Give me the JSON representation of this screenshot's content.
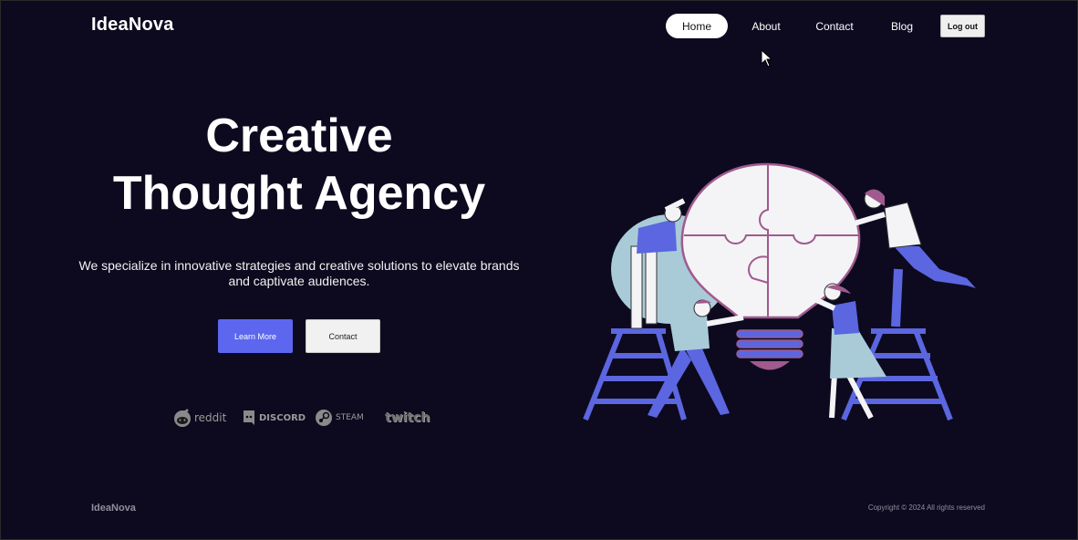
{
  "header": {
    "brand": "IdeaNova",
    "nav": [
      {
        "label": "Home",
        "active": true
      },
      {
        "label": "About",
        "active": false
      },
      {
        "label": "Contact",
        "active": false
      },
      {
        "label": "Blog",
        "active": false
      }
    ],
    "logout_label": "Log out"
  },
  "hero": {
    "title_line1": "Creative",
    "title_line2": "Thought Agency",
    "subtitle": "We specialize in innovative strategies and creative solutions to elevate brands and captivate audiences.",
    "primary_button": "Learn More",
    "secondary_button": "Contact"
  },
  "partners": [
    {
      "name": "reddit",
      "icon": "reddit-icon"
    },
    {
      "name": "DISCORD",
      "icon": "discord-icon"
    },
    {
      "name": "STEAM",
      "icon": "steam-icon"
    },
    {
      "name": "twitch",
      "icon": "twitch-icon"
    }
  ],
  "illustration": {
    "icon": "lightbulb-puzzle-team-illustration"
  },
  "footer": {
    "brand": "IdeaNova",
    "copyright": "Copyright © 2024 All rights reserved"
  },
  "colors": {
    "background": "#0d0a1f",
    "accent": "#5c66ee",
    "figure_blue": "#5b66e0",
    "bulb_outline": "#a05a8e",
    "soft_blue": "#a9cbd8"
  }
}
